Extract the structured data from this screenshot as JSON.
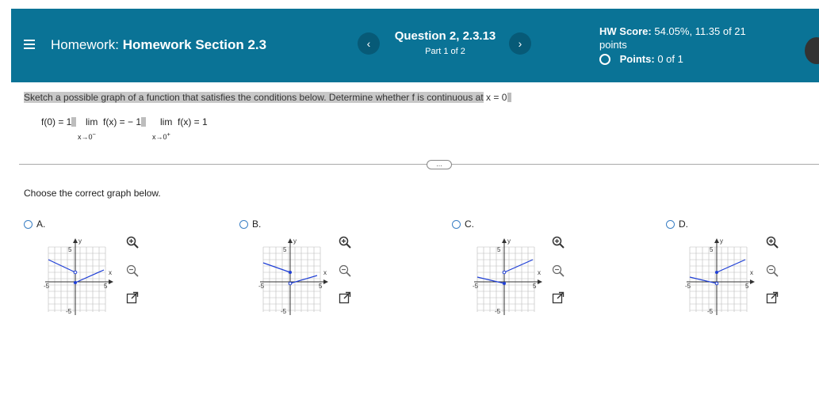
{
  "header": {
    "homework_prefix": "Homework:",
    "homework_name": "Homework Section 2.3",
    "question_title": "Question 2, 2.3.13",
    "question_part": "Part 1 of 2",
    "prev_label": "‹",
    "next_label": "›",
    "hw_score_label": "HW Score:",
    "hw_score_value": "54.05%, 11.35 of 21",
    "hw_score_unit": "points",
    "points_label": "Points:",
    "points_value": "0 of 1"
  },
  "question": {
    "instruction": "Sketch a possible graph of a function that satisfies the conditions below. Determine whether f is continuous at",
    "instruction_point": "x = 0",
    "cond1": "f(0) = 1",
    "cond2_lim": "lim",
    "cond2_fx": "f(x) = − 1",
    "cond2_sub": "x→0",
    "cond2_sup": "−",
    "cond3_lim": "lim",
    "cond3_fx": "f(x) = 1",
    "cond3_sub": "x→0",
    "cond3_sup": "+",
    "expand_label": "...",
    "choose": "Choose the correct graph below."
  },
  "options": [
    {
      "letter": "A.",
      "ticks": {
        "x_pos": "5",
        "x_neg": "-5",
        "y_pos": "5",
        "y_neg": "-5"
      },
      "axis_x": "x",
      "axis_y": "y"
    },
    {
      "letter": "B.",
      "ticks": {
        "x_pos": "5",
        "x_neg": "-5",
        "y_pos": "5",
        "y_neg": "-5"
      },
      "axis_x": "x",
      "axis_y": "y"
    },
    {
      "letter": "C.",
      "ticks": {
        "x_pos": "5",
        "x_neg": "-5",
        "y_pos": "5",
        "y_neg": "-5"
      },
      "axis_x": "x",
      "axis_y": "y"
    },
    {
      "letter": "D.",
      "ticks": {
        "x_pos": "5",
        "x_neg": "-5",
        "y_pos": "5",
        "y_neg": "-5"
      },
      "axis_x": "x",
      "axis_y": "y"
    }
  ],
  "colors": {
    "header_bg": "#0a7396",
    "curve": "#1f3fd6",
    "radio": "#3a7fc4"
  },
  "icons": [
    "menu-icon",
    "zoom-in-icon",
    "zoom-out-icon",
    "open-external-icon"
  ]
}
